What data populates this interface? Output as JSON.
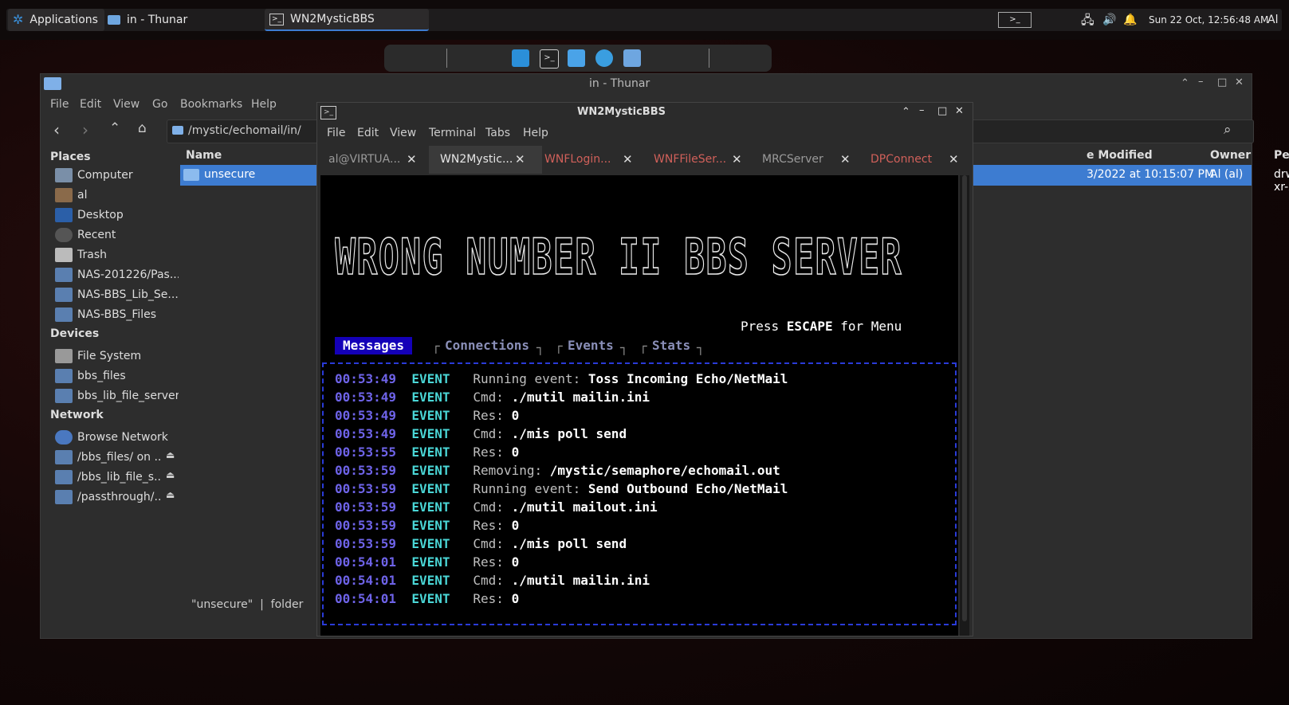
{
  "taskbar": {
    "applications": "Applications",
    "window1": "in - Thunar",
    "window2": "WN2MysticBBS",
    "clock": "Sun 22 Oct, 12:56:48 AM",
    "user": "Al"
  },
  "thunar": {
    "title": "in - Thunar",
    "menu": [
      "File",
      "Edit",
      "View",
      "Go",
      "Bookmarks",
      "Help"
    ],
    "path": "/mystic/echomail/in/",
    "places_head": "Places",
    "places": [
      "Computer",
      "al",
      "Desktop",
      "Recent",
      "Trash",
      "NAS-201226/Pas...",
      "NAS-BBS_Lib_Se...",
      "NAS-BBS_Files"
    ],
    "devices_head": "Devices",
    "devices": [
      "File System",
      "bbs_files",
      "bbs_lib_file_server"
    ],
    "network_head": "Network",
    "network": [
      "Browse Network",
      "/bbs_files/ on ...",
      "/bbs_lib_file_s...",
      "/passthrough/..."
    ],
    "columns": {
      "name": "Name",
      "modified": "e Modified",
      "owner": "Owner",
      "permissions": "Permissions"
    },
    "row": {
      "name": "unsecure",
      "modified": "3/2022 at 10:15:07 PM",
      "owner": "Al (al)",
      "permissions": "drwxr-xr-x"
    },
    "status": "\"unsecure\"  |  folder"
  },
  "terminal": {
    "title": "WN2MysticBBS",
    "menu": [
      "File",
      "Edit",
      "View",
      "Terminal",
      "Tabs",
      "Help"
    ],
    "tabs": [
      {
        "label": "al@VIRTUA...",
        "color": "#9a9a9a"
      },
      {
        "label": "WN2Mystic...",
        "color": "#e6e6e6"
      },
      {
        "label": "WNFLogin...",
        "color": "#d0605a"
      },
      {
        "label": "WNFFileSer...",
        "color": "#d0605a"
      },
      {
        "label": "MRCServer",
        "color": "#9a9a9a"
      },
      {
        "label": "DPConnect",
        "color": "#d0605a"
      }
    ],
    "banner": "WRONG NUMBER II BBS SERVER",
    "press_prefix": "Press ",
    "press_key": "ESCAPE",
    "press_suffix": " for Menu",
    "nav": {
      "messages": "Messages",
      "connections": "Connections",
      "events": "Events",
      "stats": "Stats"
    },
    "log": [
      {
        "time": "00:53:49",
        "type": "EVENT",
        "label": "Running event:",
        "value": "Toss Incoming Echo/NetMail"
      },
      {
        "time": "00:53:49",
        "type": "EVENT",
        "label": "Cmd:",
        "value": "./mutil mailin.ini"
      },
      {
        "time": "00:53:49",
        "type": "EVENT",
        "label": "Res:",
        "value": "0"
      },
      {
        "time": "00:53:49",
        "type": "EVENT",
        "label": "Cmd:",
        "value": "./mis poll send"
      },
      {
        "time": "00:53:55",
        "type": "EVENT",
        "label": "Res:",
        "value": "0"
      },
      {
        "time": "00:53:59",
        "type": "EVENT",
        "label": "Removing:",
        "value": "/mystic/semaphore/echomail.out"
      },
      {
        "time": "00:53:59",
        "type": "EVENT",
        "label": "Running event:",
        "value": "Send Outbound Echo/NetMail"
      },
      {
        "time": "00:53:59",
        "type": "EVENT",
        "label": "Cmd:",
        "value": "./mutil mailout.ini"
      },
      {
        "time": "00:53:59",
        "type": "EVENT",
        "label": "Res:",
        "value": "0"
      },
      {
        "time": "00:53:59",
        "type": "EVENT",
        "label": "Cmd:",
        "value": "./mis poll send"
      },
      {
        "time": "00:54:01",
        "type": "EVENT",
        "label": "Res:",
        "value": "0"
      },
      {
        "time": "00:54:01",
        "type": "EVENT",
        "label": "Cmd:",
        "value": "./mutil mailin.ini"
      },
      {
        "time": "00:54:01",
        "type": "EVENT",
        "label": "Res:",
        "value": "0"
      }
    ]
  }
}
